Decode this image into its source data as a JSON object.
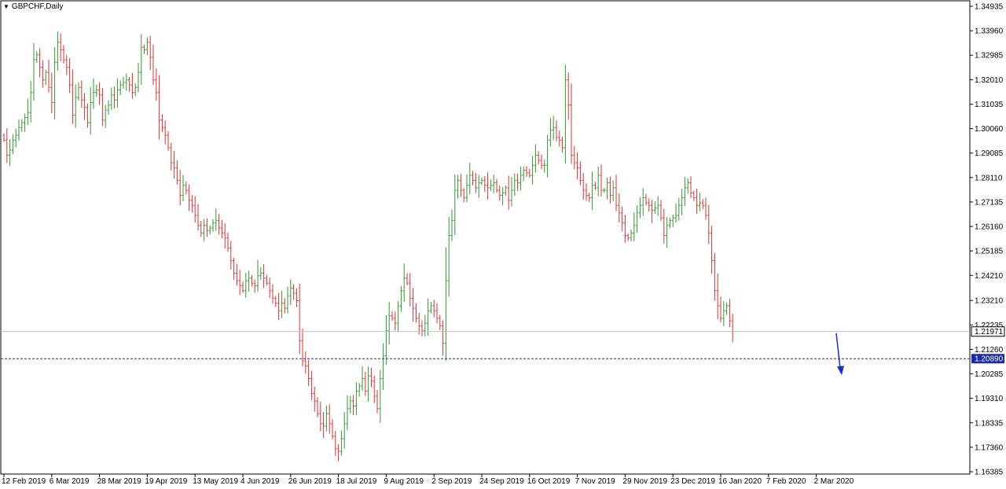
{
  "window": {
    "title": "GBPCHF,Daily"
  },
  "colors": {
    "up": "#2e9a2e",
    "down": "#e03030",
    "price_line": "#c0c0c0",
    "level": "#1f2d8a",
    "arrow": "#1a2fd0",
    "level_tag_bg": "#1a2aa0",
    "axis": "#000000"
  },
  "current_price": {
    "value": 1.21971,
    "label": "1.21971"
  },
  "level_line": {
    "value": 1.2089,
    "label": "1.20890"
  },
  "chart_data": {
    "type": "ohlc-bar",
    "symbol": "GBPCHF",
    "timeframe": "Daily",
    "ylim": [
      1.16385,
      1.34935
    ],
    "y_ticks": [
      "1.34935",
      "1.33960",
      "1.32985",
      "1.32010",
      "1.31035",
      "1.30060",
      "1.29085",
      "1.28110",
      "1.27135",
      "1.26160",
      "1.25185",
      "1.24210",
      "1.23210",
      "1.22235",
      "1.21260",
      "1.20285",
      "1.19310",
      "1.18335",
      "1.17360",
      "1.16385"
    ],
    "x_ticks": [
      {
        "label": "12 Feb 2019",
        "bar": 0
      },
      {
        "label": "6 Mar 2019",
        "bar": 16
      },
      {
        "label": "28 Mar 2019",
        "bar": 32
      },
      {
        "label": "19 Apr 2019",
        "bar": 48
      },
      {
        "label": "13 May 2019",
        "bar": 64
      },
      {
        "label": "4 Jun 2019",
        "bar": 80
      },
      {
        "label": "26 Jun 2019",
        "bar": 96
      },
      {
        "label": "18 Jul 2019",
        "bar": 112
      },
      {
        "label": "9 Aug 2019",
        "bar": 128
      },
      {
        "label": "2 Sep 2019",
        "bar": 144
      },
      {
        "label": "24 Sep 2019",
        "bar": 160
      },
      {
        "label": "16 Oct 2019",
        "bar": 176
      },
      {
        "label": "7 Nov 2019",
        "bar": 192
      },
      {
        "label": "29 Nov 2019",
        "bar": 208
      },
      {
        "label": "23 Dec 2019",
        "bar": 224
      },
      {
        "label": "16 Jan 2020",
        "bar": 240
      },
      {
        "label": "7 Feb 2020",
        "bar": 256
      },
      {
        "label": "2 Mar 2020",
        "bar": 272
      }
    ],
    "closes": [
      1.296,
      1.29,
      1.292,
      1.296,
      1.298,
      1.301,
      1.303,
      1.305,
      1.307,
      1.315,
      1.328,
      1.33,
      1.325,
      1.32,
      1.323,
      1.317,
      1.311,
      1.327,
      1.335,
      1.332,
      1.328,
      1.325,
      1.318,
      1.306,
      1.313,
      1.317,
      1.312,
      1.309,
      1.303,
      1.311,
      1.315,
      1.316,
      1.314,
      1.304,
      1.308,
      1.31,
      1.314,
      1.312,
      1.316,
      1.318,
      1.319,
      1.32,
      1.318,
      1.315,
      1.317,
      1.323,
      1.333,
      1.332,
      1.335,
      1.329,
      1.32,
      1.315,
      1.304,
      1.301,
      1.298,
      1.293,
      1.287,
      1.285,
      1.28,
      1.274,
      1.278,
      1.276,
      1.272,
      1.27,
      1.266,
      1.262,
      1.259,
      1.262,
      1.26,
      1.261,
      1.263,
      1.264,
      1.261,
      1.259,
      1.257,
      1.253,
      1.248,
      1.243,
      1.24,
      1.238,
      1.236,
      1.24,
      1.241,
      1.239,
      1.238,
      1.242,
      1.243,
      1.241,
      1.239,
      1.236,
      1.233,
      1.231,
      1.228,
      1.231,
      1.229,
      1.234,
      1.237,
      1.235,
      1.232,
      1.216,
      1.208,
      1.206,
      1.201,
      1.195,
      1.192,
      1.187,
      1.183,
      1.182,
      1.187,
      1.183,
      1.178,
      1.173,
      1.172,
      1.177,
      1.183,
      1.189,
      1.192,
      1.19,
      1.196,
      1.198,
      1.201,
      1.196,
      1.202,
      1.2,
      1.194,
      1.189,
      1.201,
      1.21,
      1.22,
      1.226,
      1.225,
      1.223,
      1.23,
      1.236,
      1.241,
      1.239,
      1.233,
      1.229,
      1.225,
      1.222,
      1.22,
      1.223,
      1.228,
      1.23,
      1.228,
      1.225,
      1.222,
      1.215,
      1.24,
      1.258,
      1.264,
      1.276,
      1.28,
      1.276,
      1.273,
      1.278,
      1.282,
      1.28,
      1.277,
      1.279,
      1.28,
      1.278,
      1.277,
      1.278,
      1.279,
      1.276,
      1.274,
      1.275,
      1.277,
      1.272,
      1.276,
      1.28,
      1.279,
      1.282,
      1.284,
      1.283,
      1.282,
      1.286,
      1.29,
      1.288,
      1.286,
      1.286,
      1.296,
      1.3,
      1.301,
      1.297,
      1.296,
      1.293,
      1.32,
      1.31,
      1.29,
      1.287,
      1.285,
      1.28,
      1.276,
      1.274,
      1.273,
      1.278,
      1.277,
      1.282,
      1.276,
      1.276,
      1.279,
      1.274,
      1.277,
      1.27,
      1.267,
      1.263,
      1.258,
      1.257,
      1.259,
      1.262,
      1.267,
      1.27,
      1.273,
      1.271,
      1.27,
      1.268,
      1.269,
      1.27,
      1.265,
      1.258,
      1.262,
      1.264,
      1.265,
      1.266,
      1.27,
      1.273,
      1.277,
      1.279,
      1.275,
      1.273,
      1.27,
      1.271,
      1.27,
      1.266,
      1.259,
      1.248,
      1.236,
      1.23,
      1.225,
      1.228,
      1.23,
      1.224,
      1.2197
    ]
  }
}
